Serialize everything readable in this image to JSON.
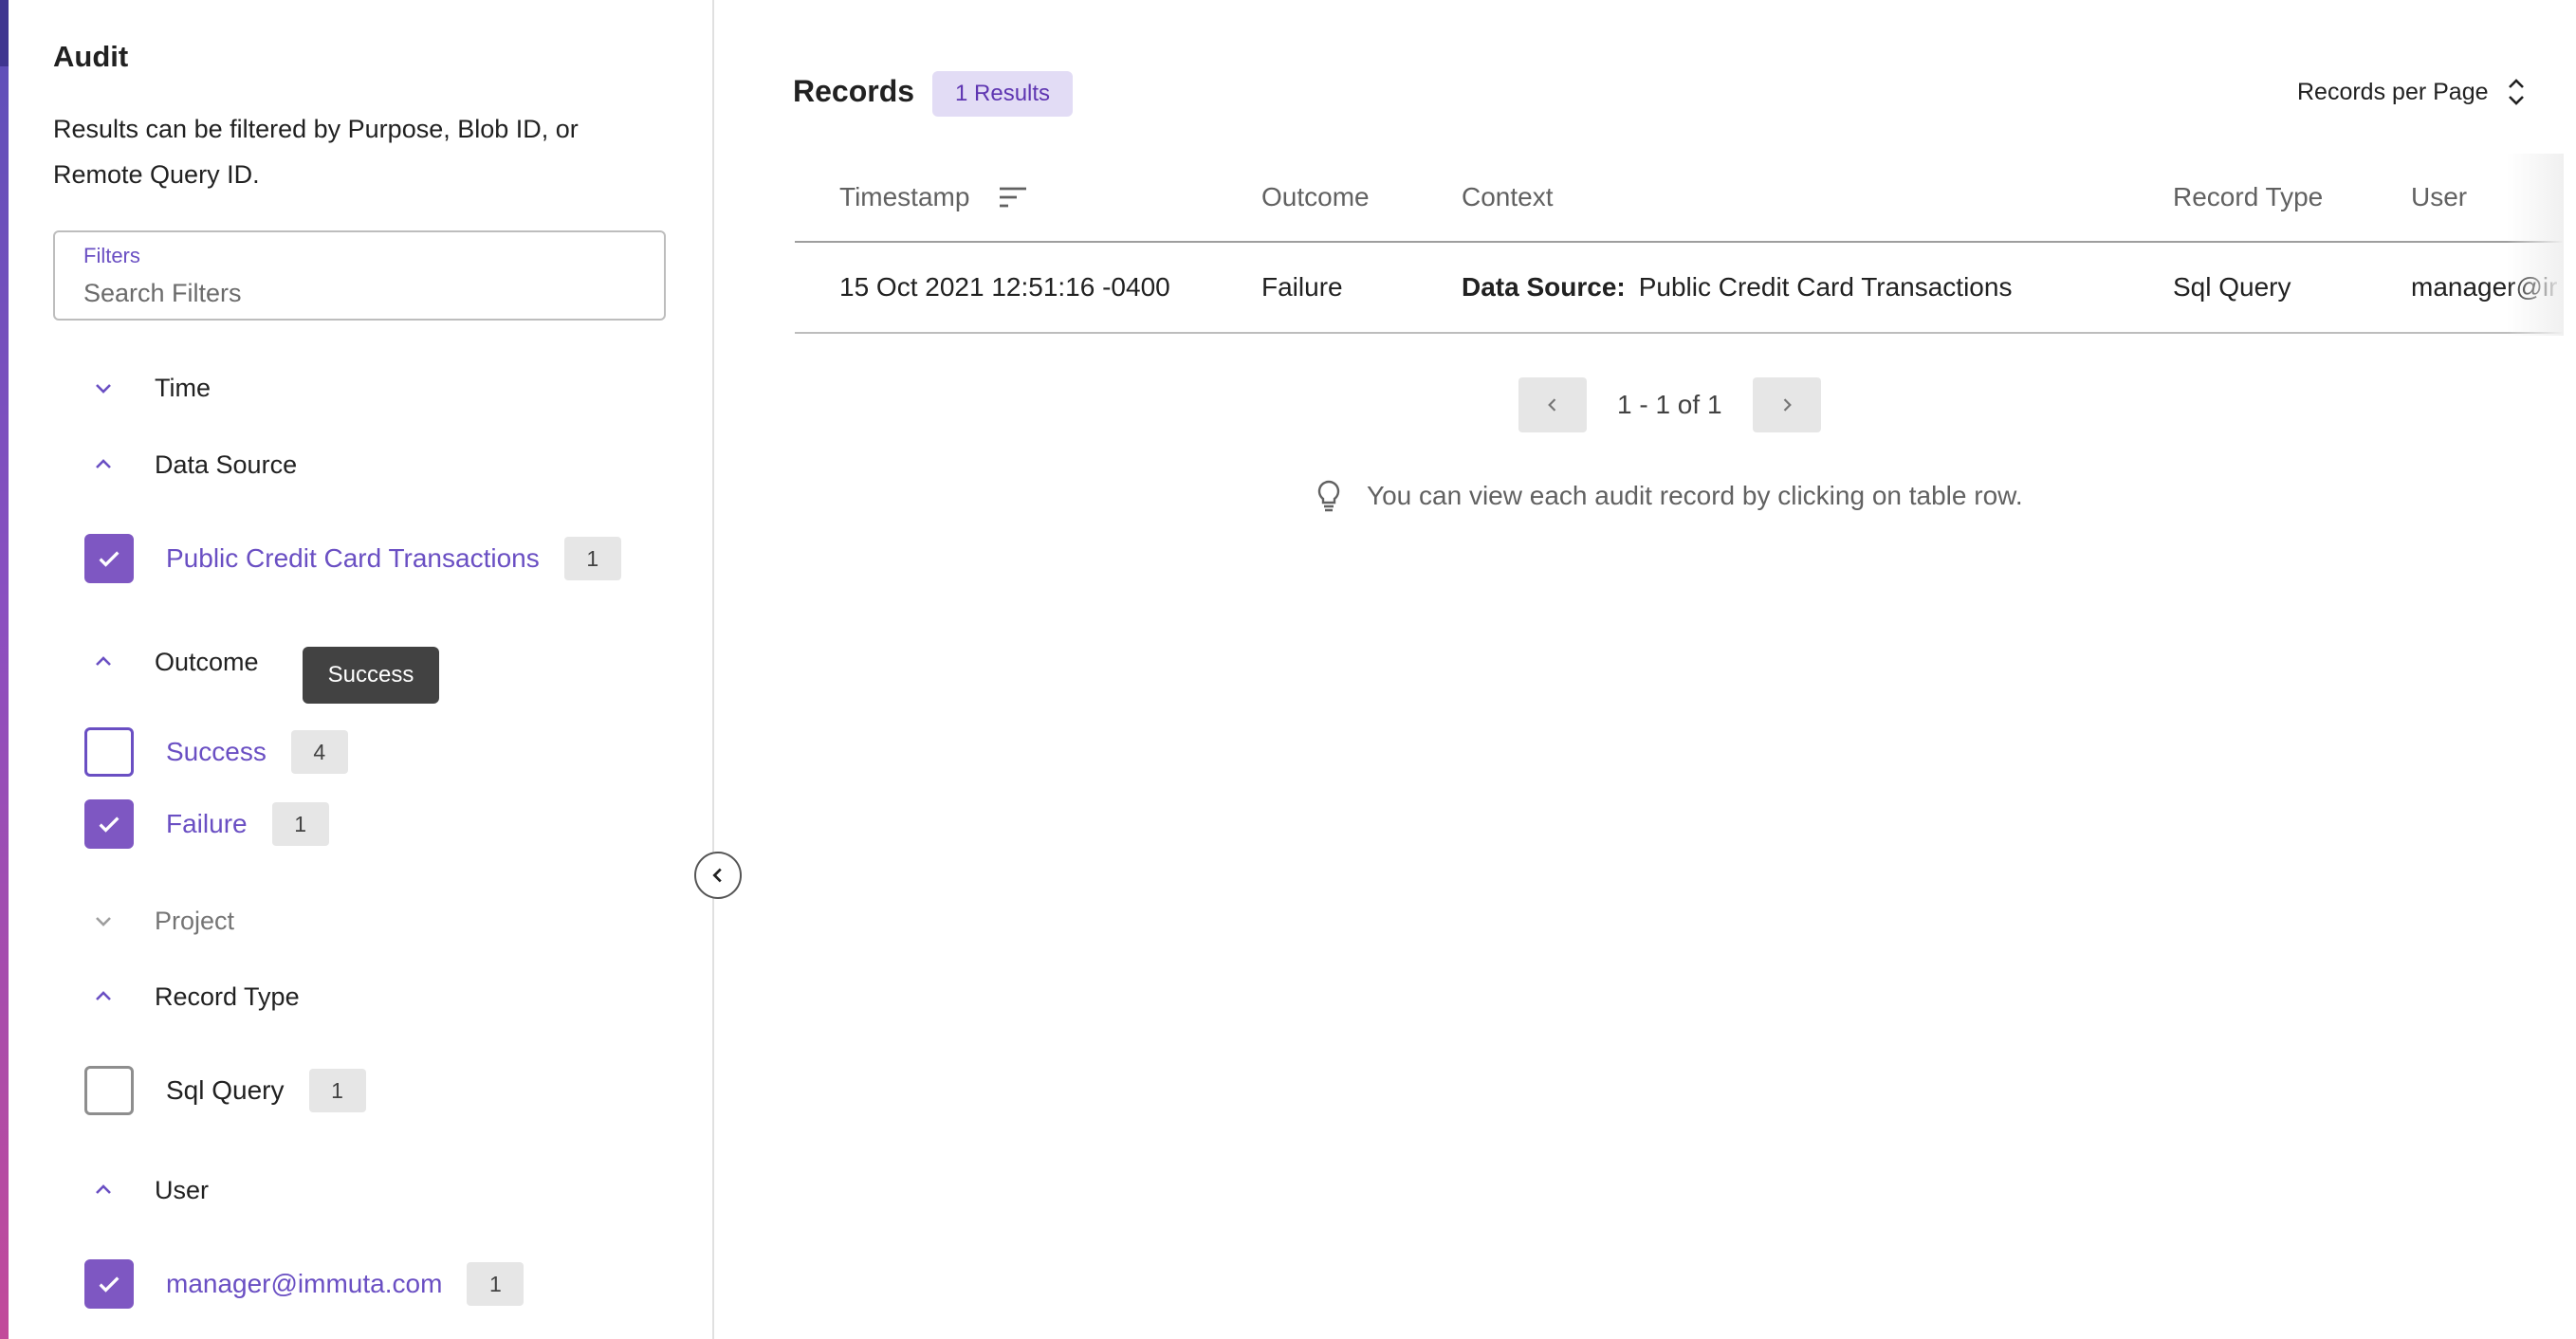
{
  "sidebar": {
    "title": "Audit",
    "description": "Results can be filtered by Purpose, Blob ID, or Remote Query ID.",
    "filter": {
      "label": "Filters",
      "placeholder": "Search Filters"
    },
    "sections": {
      "time": {
        "title": "Time",
        "expanded": false
      },
      "data_source": {
        "title": "Data Source",
        "expanded": true,
        "options": [
          {
            "label": "Public Credit Card Transactions",
            "count": "1",
            "checked": true
          }
        ]
      },
      "outcome": {
        "title": "Outcome",
        "expanded": true,
        "tooltip": "Success",
        "options": [
          {
            "label": "Success",
            "count": "4",
            "checked": false
          },
          {
            "label": "Failure",
            "count": "1",
            "checked": true
          }
        ]
      },
      "project": {
        "title": "Project",
        "expanded": false
      },
      "record_type": {
        "title": "Record Type",
        "expanded": true,
        "options": [
          {
            "label": "Sql Query",
            "count": "1",
            "checked": false
          }
        ]
      },
      "user": {
        "title": "User",
        "expanded": true,
        "options": [
          {
            "label": "manager@immuta.com",
            "count": "1",
            "checked": true
          }
        ]
      }
    }
  },
  "main": {
    "title": "Records",
    "results_badge": "1 Results",
    "records_per_page": "Records per Page",
    "table": {
      "columns": [
        "Timestamp",
        "Outcome",
        "Context",
        "Record Type",
        "User"
      ],
      "rows": [
        {
          "timestamp": "15 Oct 2021 12:51:16 -0400",
          "outcome": "Failure",
          "context_key": "Data Source:",
          "context_value": "Public Credit Card Transactions",
          "record_type": "Sql Query",
          "user": "manager@ir"
        }
      ]
    },
    "pagination": {
      "text": "1 - 1 of 1"
    },
    "hint": "You can view each audit record by clicking on table row."
  },
  "colors": {
    "accent": "#7e57c2",
    "accent_text": "#6a4fc3",
    "badge_bg": "#e2dcf5",
    "tooltip_bg": "#424242"
  },
  "icons": {
    "collapsed": "chevron-down-icon",
    "expanded": "chevron-up-icon",
    "checked": "check-icon",
    "sort": "sort-lines-icon",
    "records_per_page": "unfold-icon",
    "collapse_sidebar": "chevron-left-icon",
    "prev": "chevron-left-icon",
    "next": "chevron-right-icon",
    "hint": "lightbulb-icon"
  }
}
